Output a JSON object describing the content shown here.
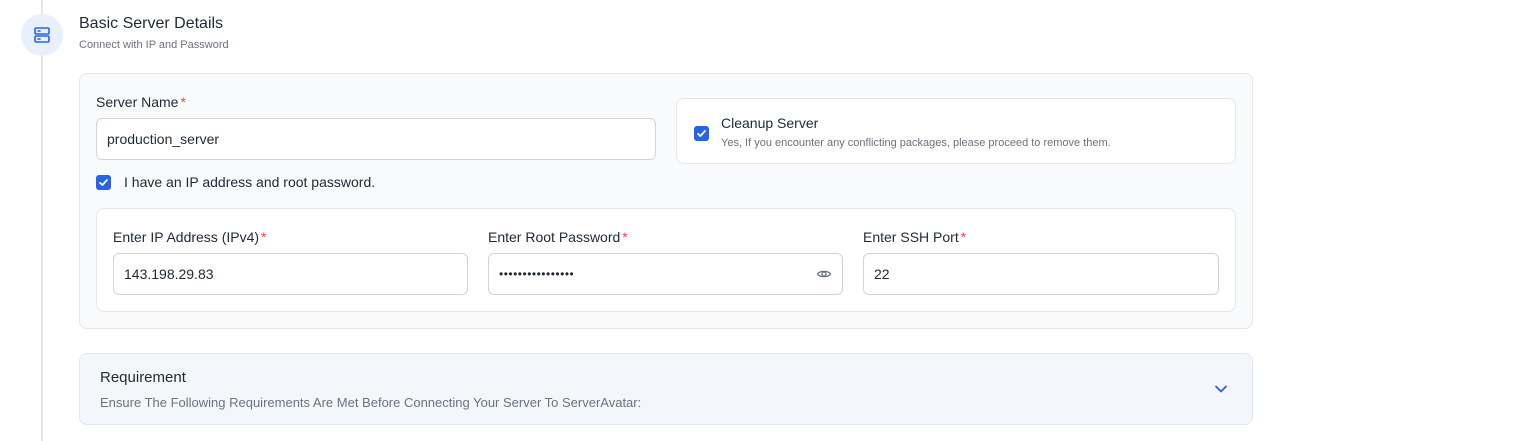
{
  "section": {
    "title": "Basic Server Details",
    "subtitle": "Connect with IP and Password"
  },
  "server_name": {
    "label": "Server Name",
    "required_mark": "*",
    "value": "production_server"
  },
  "cleanup": {
    "title": "Cleanup Server",
    "description": "Yes, If you encounter any conflicting packages, please proceed to remove them.",
    "checked": true
  },
  "ip_password_checkbox": {
    "label": "I have an IP address and root password.",
    "checked": true
  },
  "ip_field": {
    "label": "Enter IP Address (IPv4)",
    "required_mark": "*",
    "value": "143.198.29.83"
  },
  "password_field": {
    "label": "Enter Root Password",
    "required_mark": "*",
    "value": "••••••••••••••••"
  },
  "ssh_port_field": {
    "label": "Enter SSH Port",
    "required_mark": "*",
    "value": "22"
  },
  "requirement": {
    "title": "Requirement",
    "description": "Ensure The Following Requirements Are Met Before Connecting Your Server To ServerAvatar:"
  },
  "icons": {
    "step": "server-icon",
    "check": "check-icon",
    "eye": "eye-icon",
    "chevron": "chevron-down-icon"
  },
  "colors": {
    "accent": "#2563eb",
    "required": "#ef4444"
  }
}
